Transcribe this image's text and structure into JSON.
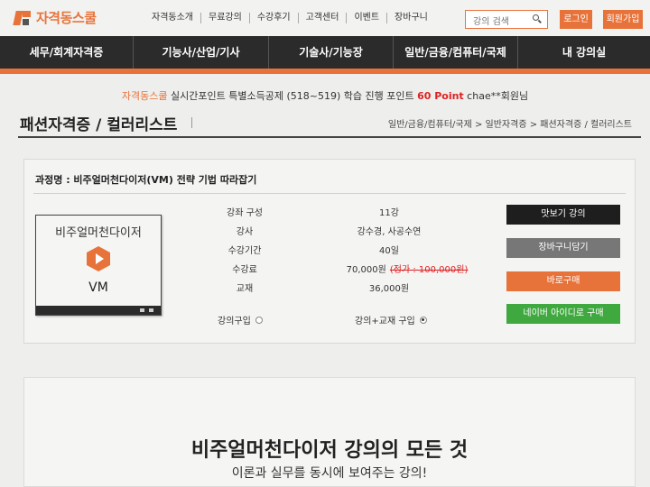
{
  "brand": {
    "logo_text": "자격동스쿨",
    "logo_icon": "brand-logo-icon"
  },
  "top_nav": {
    "items": [
      "자격동소개",
      "무료강의",
      "수강후기",
      "고객센터",
      "이벤트",
      "장바구니"
    ],
    "search_placeholder": "강의 검색",
    "login_label": "로그인",
    "join_label": "회원가입"
  },
  "main_nav": {
    "tabs": [
      "세무/회계자격증",
      "기능사/산업/기사",
      "기술사/기능장",
      "일반/금융/컴퓨터/국제",
      "내 강의실"
    ]
  },
  "notice": {
    "brand": "자격동스쿨",
    "text": " 실시간포인트 특별소득공제 (518~519) 학습 진행 포인트 ",
    "points": "60 Point",
    "user": " chae**회원님"
  },
  "page": {
    "title": "패션자격증 / 컬러리스트",
    "breadcrumb": "일반/금융/컴퓨터/국제 > 일반자격증 > 패션자격증 / 컬러리스트"
  },
  "course": {
    "name_label": "과정명 : ",
    "name": "비주얼머천다이저(VM) 전략 기법 따라잡기",
    "thumb_title": "비주얼머천다이저",
    "thumb_sub": "VM",
    "rows": [
      {
        "label": "강좌 구성",
        "value": "11강"
      },
      {
        "label": "강사",
        "value": "강수경, 사공수연"
      },
      {
        "label": "수강기간",
        "value": "40일"
      },
      {
        "label": "수강료",
        "value": "70,000원",
        "strike": "(정가 : 100,000원)"
      },
      {
        "label": "교재",
        "value": "36,000원"
      }
    ],
    "option_lecture": "강의구입",
    "option_lecture_book": "강의+교재 구입",
    "selected_option": "강의+교재 구입",
    "buttons": {
      "preview": "맛보기 강의",
      "cart": "장바구니담기",
      "buy": "바로구매",
      "naver": "네이버 아이디로 구매"
    },
    "colors": {
      "preview": "#1e1e1e",
      "cart": "#777777",
      "buy": "#e8733a",
      "naver": "#3fa83f"
    }
  },
  "promo": {
    "title": "비주얼머천다이저 강의의 모든 것",
    "subtitle": "이론과 실무를 동시에 보여주는 강의!"
  },
  "colors": {
    "accent": "#e8733a",
    "dark": "#2b2b2b"
  }
}
